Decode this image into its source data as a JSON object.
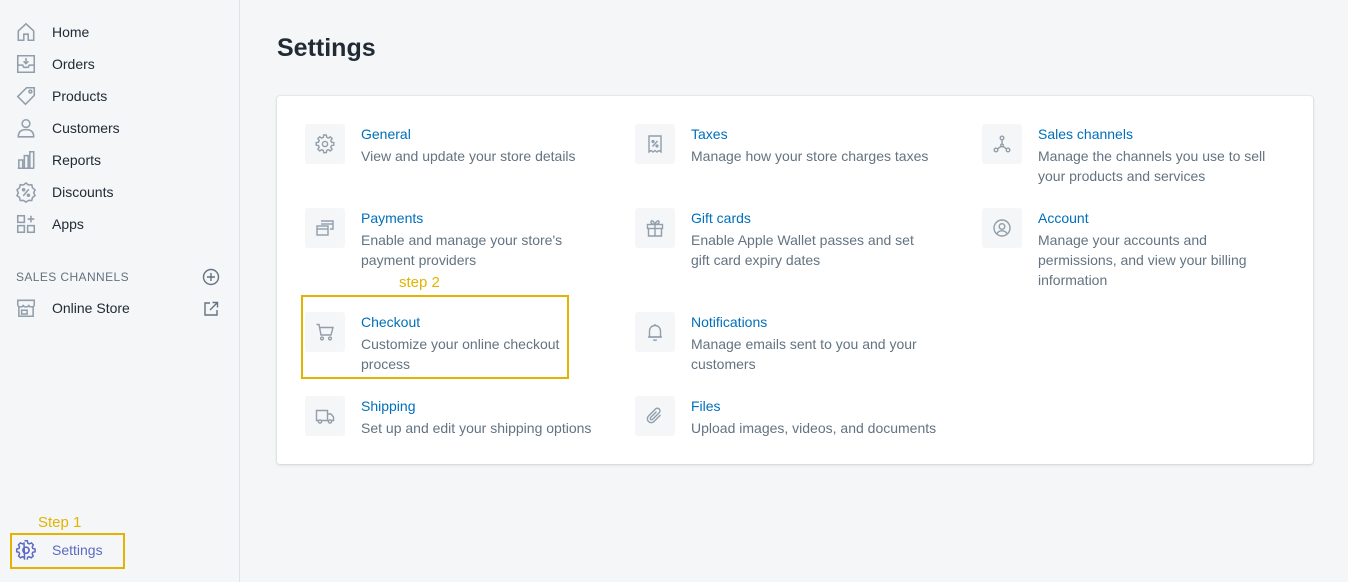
{
  "sidebar": {
    "items": [
      {
        "label": "Home",
        "icon": "home-icon"
      },
      {
        "label": "Orders",
        "icon": "orders-icon"
      },
      {
        "label": "Products",
        "icon": "tag-icon"
      },
      {
        "label": "Customers",
        "icon": "person-icon"
      },
      {
        "label": "Reports",
        "icon": "bar-chart-icon"
      },
      {
        "label": "Discounts",
        "icon": "discount-icon"
      },
      {
        "label": "Apps",
        "icon": "apps-icon"
      }
    ],
    "sales_channels_header": "SALES CHANNELS",
    "online_store_label": "Online Store",
    "settings_label": "Settings"
  },
  "annotations": {
    "step1": "Step 1",
    "step2": "step 2",
    "highlight_color": "#e2b300"
  },
  "main": {
    "title": "Settings",
    "settings": [
      {
        "title": "General",
        "desc": "View and update your store details",
        "icon": "gear-icon"
      },
      {
        "title": "Taxes",
        "desc": "Manage how your store charges taxes",
        "icon": "receipt-icon"
      },
      {
        "title": "Sales channels",
        "desc": "Manage the channels you use to sell your products and services",
        "icon": "channels-icon"
      },
      {
        "title": "Payments",
        "desc": "Enable and manage your store's payment providers",
        "icon": "payments-icon"
      },
      {
        "title": "Gift cards",
        "desc": "Enable Apple Wallet passes and set gift card expiry dates",
        "icon": "gift-icon"
      },
      {
        "title": "Account",
        "desc": "Manage your accounts and permissions, and view your billing information",
        "icon": "account-icon"
      },
      {
        "title": "Checkout",
        "desc": "Customize your online checkout process",
        "icon": "cart-icon"
      },
      {
        "title": "Notifications",
        "desc": "Manage emails sent to you and your customers",
        "icon": "bell-icon"
      },
      {
        "title": "Shipping",
        "desc": "Set up and edit your shipping options",
        "icon": "truck-icon"
      },
      {
        "title": "Files",
        "desc": "Upload images, videos, and documents",
        "icon": "paperclip-icon"
      }
    ]
  },
  "colors": {
    "link": "#006fbb",
    "icon": "#919eab",
    "active_nav": "#5c6ac4"
  }
}
